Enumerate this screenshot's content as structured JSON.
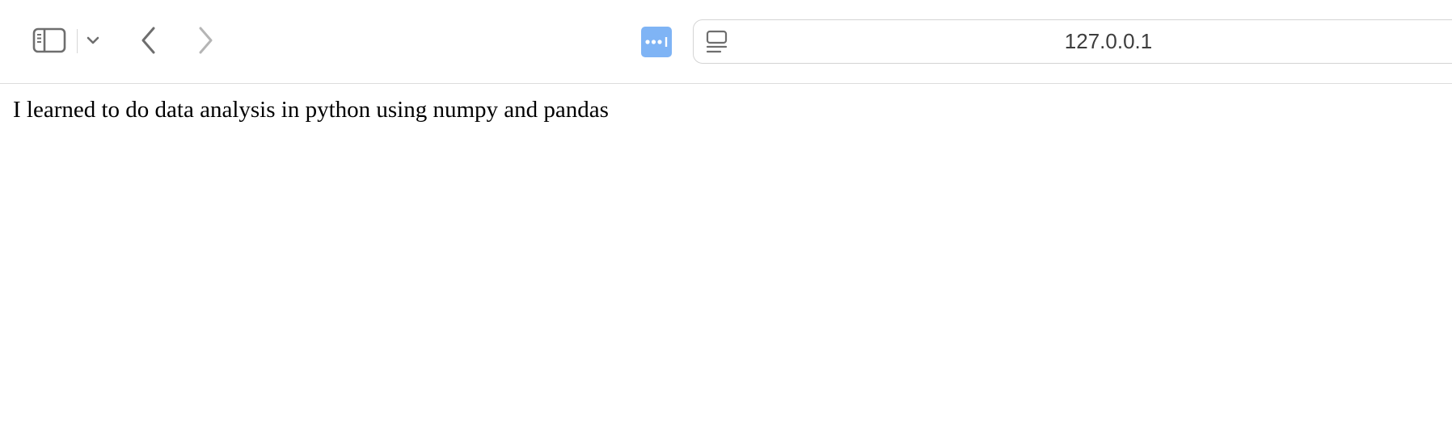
{
  "browser": {
    "address_bar": {
      "url": "127.0.0.1"
    },
    "icons": {
      "sidebar": "sidebar-icon",
      "sidebar_menu": "chevron-down-icon",
      "back": "chevron-left-icon",
      "forward": "chevron-right-icon",
      "extension": "extension-dots-icon",
      "reader": "reader-view-icon"
    },
    "colors": {
      "extension_accent": "#7fb4f5",
      "toolbar_icon": "#6e6e6e",
      "disabled_icon": "#b5b5b5"
    }
  },
  "page": {
    "text": "I learned to do data analysis in python using numpy and pandas"
  }
}
